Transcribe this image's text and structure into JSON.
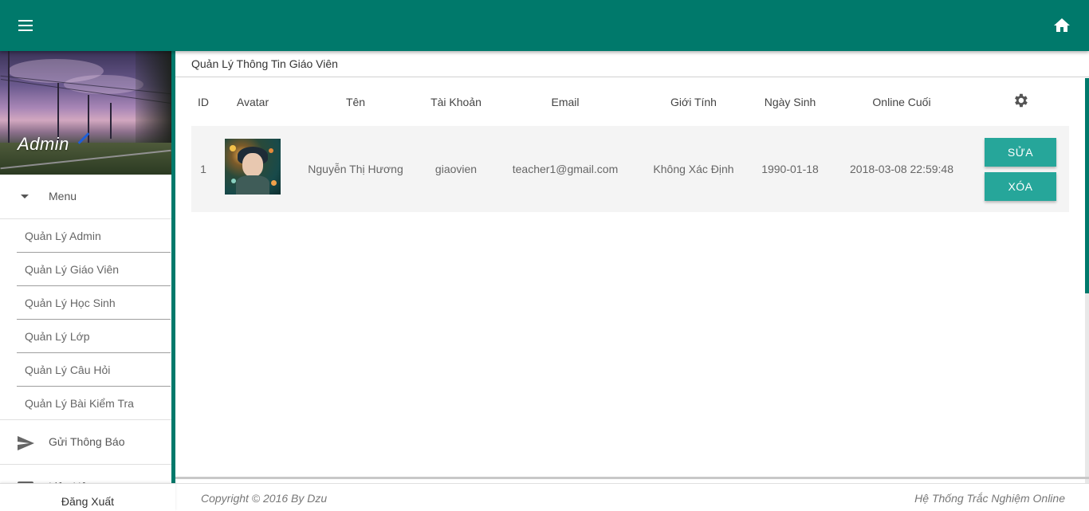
{
  "header": {
    "menu_icon": "hamburger-icon",
    "home_icon": "home-icon"
  },
  "sidebar": {
    "admin_label": "Admin",
    "menu_label": "Menu",
    "items": [
      {
        "label": "Quản Lý Admin"
      },
      {
        "label": "Quản Lý Giáo Viên"
      },
      {
        "label": "Quản Lý Học Sinh"
      },
      {
        "label": "Quản Lý Lớp"
      },
      {
        "label": "Quản Lý Câu Hỏi"
      },
      {
        "label": "Quản Lý Bài Kiểm Tra"
      }
    ],
    "send_notice": "Gửi Thông Báo",
    "contact": "Liên Hệ",
    "logout": "Đăng Xuất"
  },
  "main": {
    "title": "Quản Lý Thông Tin Giáo Viên",
    "columns": [
      "ID",
      "Avatar",
      "Tên",
      "Tài Khoản",
      "Email",
      "Giới Tính",
      "Ngày Sinh",
      "Online Cuối"
    ],
    "settings_icon": "gear-icon",
    "rows": [
      {
        "id": "1",
        "name": "Nguyễn Thị Hương",
        "account": "giaovien",
        "email": "teacher1@gmail.com",
        "gender": "Không Xác Định",
        "birthday": "1990-01-18",
        "last_online": "2018-03-08 22:59:48",
        "edit_label": "SỬA",
        "delete_label": "XÓA"
      }
    ]
  },
  "footer": {
    "copyright": "Copyright © 2016 By Dzu",
    "system": "Hệ Thống Trắc Nghiệm Online"
  },
  "colors": {
    "primary": "#00796b",
    "button": "#26a69a",
    "row_bg": "#f4f4f4"
  }
}
